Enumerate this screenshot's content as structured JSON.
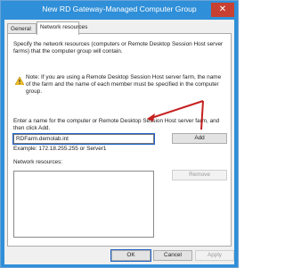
{
  "window": {
    "title": "New RD Gateway-Managed Computer Group",
    "close_glyph": "✕"
  },
  "tabs": [
    {
      "label": "General"
    },
    {
      "label": "Network resources"
    }
  ],
  "panel": {
    "description": "Specify the network resources (computers or Remote Desktop Session Host server farms) that the computer group will contain.",
    "note": "Note: If you are using a Remote Desktop Session Host server farm, the name of the farm and the name of each member must be specified in the computer group.",
    "prompt": "Enter a name for the computer or Remote Desktop Session Host server farm, and then click Add.",
    "input_value": "RDFarm.demolab.int",
    "add_label": "Add",
    "example": "Example: 172.18.255.255 or Server1",
    "resources_label": "Network resources:",
    "remove_label": "Remove"
  },
  "footer": {
    "ok_label": "OK",
    "cancel_label": "Cancel",
    "apply_label": "Apply"
  },
  "colors": {
    "titlebar": "#2f8fd8",
    "close": "#c84031",
    "annotation_arrow": "#c62020"
  }
}
